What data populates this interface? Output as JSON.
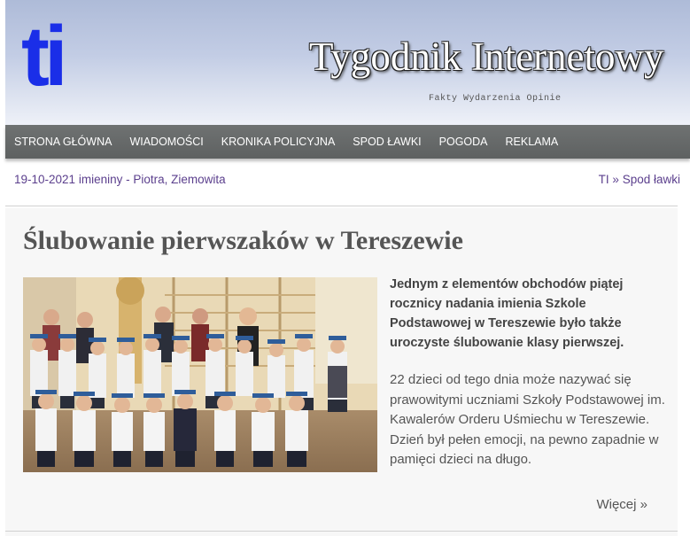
{
  "site": {
    "logo_text": "ti",
    "title": "Tygodnik Internetowy",
    "tagline": "Fakty Wydarzenia Opinie"
  },
  "nav": {
    "items": [
      "STRONA GŁÓWNA",
      "WIADOMOŚCI",
      "KRONIKA POLICYJNA",
      "SPOD ŁAWKI",
      "POGODA",
      "REKLAMA"
    ]
  },
  "info": {
    "date": "19-10-2021",
    "names": "imieniny - Piotra, Ziemowita",
    "breadcrumb_home": "TI",
    "breadcrumb_sep": "»",
    "breadcrumb_section": "Spod ławki"
  },
  "article": {
    "title": "Ślubowanie pierwszaków w Tereszewie",
    "lead": "Jednym z elementów obchodów piątej rocznicy nadania imienia Szkole Podstawowej w Tereszewie było także uroczyste ślubowanie klasy pierwszej.",
    "body": "22 dzieci od tego dnia może nazywać się prawowitymi uczniami Szkoły Podstawowej im. Kawalerów Orderu Uśmiechu w Tereszewie. Dzień był pełen emocji, na pewno zapadnie w pamięci dzieci na długo.",
    "more": "Więcej »"
  },
  "colors": {
    "logo_blue": "#1a2ee8",
    "nav_bg": "#666969",
    "link_purple": "#5b3f8d",
    "title_gray": "#555555"
  }
}
